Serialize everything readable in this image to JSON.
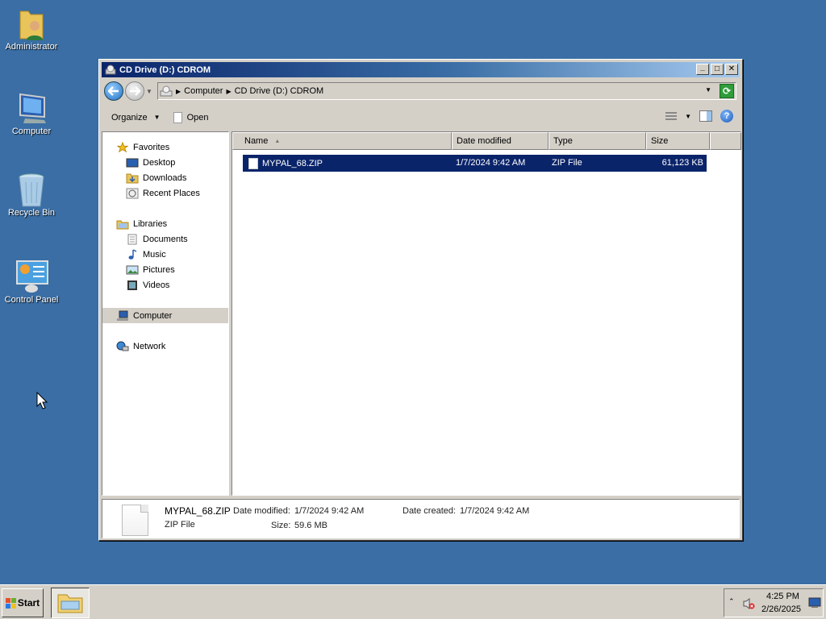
{
  "desktop": {
    "icons": [
      {
        "label": "Administrator",
        "icon": "user-folder-icon"
      },
      {
        "label": "Computer",
        "icon": "computer-icon"
      },
      {
        "label": "Recycle Bin",
        "icon": "recycle-bin-icon"
      },
      {
        "label": "Control Panel",
        "icon": "control-panel-icon"
      }
    ]
  },
  "window": {
    "title": "CD Drive (D:) CDROM",
    "controls": {
      "minimize": "_",
      "maximize": "□",
      "close": "✕"
    }
  },
  "address": {
    "segments": [
      "Computer",
      "CD Drive (D:) CDROM"
    ]
  },
  "toolbar": {
    "organize_label": "Organize",
    "open_label": "Open"
  },
  "nav": {
    "favorites_label": "Favorites",
    "favorites": [
      "Desktop",
      "Downloads",
      "Recent Places"
    ],
    "libraries_label": "Libraries",
    "libraries": [
      "Documents",
      "Music",
      "Pictures",
      "Videos"
    ],
    "computer_label": "Computer",
    "network_label": "Network"
  },
  "table": {
    "columns": [
      "Name",
      "Date modified",
      "Type",
      "Size"
    ],
    "rows": [
      {
        "name": "MYPAL_68.ZIP",
        "date": "1/7/2024 9:42 AM",
        "type": "ZIP File",
        "size": "61,123 KB"
      }
    ]
  },
  "details": {
    "filename": "MYPAL_68.ZIP",
    "filetype": "ZIP File",
    "date_modified_label": "Date modified:",
    "date_modified": "1/7/2024 9:42 AM",
    "size_label": "Size:",
    "size": "59.6 MB",
    "date_created_label": "Date created:",
    "date_created": "1/7/2024 9:42 AM"
  },
  "taskbar": {
    "start_label": "Start",
    "time": "4:25 PM",
    "date": "2/26/2025"
  },
  "colors": {
    "desktop": "#3a6ea5",
    "title_start": "#0a246a",
    "selection": "#0a246a"
  }
}
